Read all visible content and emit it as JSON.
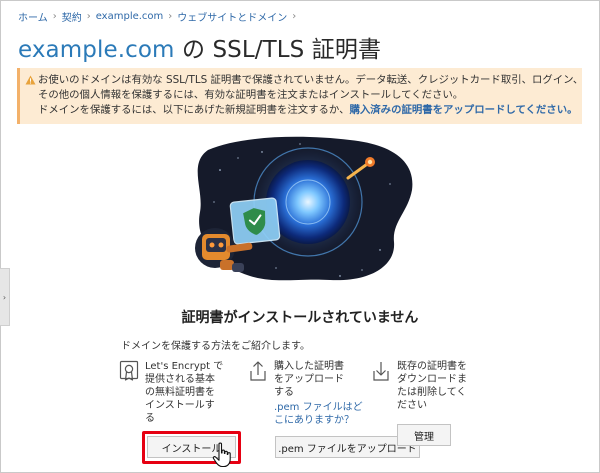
{
  "breadcrumb": {
    "items": [
      "ホーム",
      "契約",
      "example.com",
      "ウェブサイトとドメイン"
    ],
    "separator": "›"
  },
  "title": {
    "domain": "example.com",
    "rest": " の SSL/TLS 証明書"
  },
  "warning": {
    "line1": "お使いのドメインは有効な SSL/TLS 証明書で保護されていません。データ転送、クレジットカード取引、ログイン、",
    "line2": "その他の個人情報を保護するには、有効な証明書を注文またはインストールしてください。",
    "line3_prefix": "ドメインを保護するには、以下にあげた新規証明書を注文するか、",
    "line3_link": "購入済みの証明書をアップロードしてください。",
    "colors": {
      "background": "#fdebd3",
      "accent": "#f3b16a"
    }
  },
  "side_handle": {
    "glyph": "›"
  },
  "main": {
    "heading": "証明書がインストールされていません",
    "intro": "ドメインを保護する方法をご紹介します。"
  },
  "options": [
    {
      "icon": "certificate-icon",
      "lines": [
        "Let's Encrypt で",
        "提供される基本",
        "の無料証明書を",
        "インストールす",
        "る"
      ],
      "button": "インストール"
    },
    {
      "icon": "upload-icon",
      "lines": [
        "購入した証明書",
        "をアップロード",
        "する"
      ],
      "link_lines": [
        ".pem ファイルはど",
        "こにありますか？"
      ],
      "button": ".pem ファイルをアップロード"
    },
    {
      "icon": "download-icon",
      "lines": [
        "既存の証明書を",
        "ダウンロードま",
        "たは削除してく",
        "ださい"
      ],
      "button": "管理"
    }
  ],
  "colors": {
    "link": "#2f69a8",
    "highlight": "#e60012",
    "title_domain": "#2b7ab8"
  }
}
